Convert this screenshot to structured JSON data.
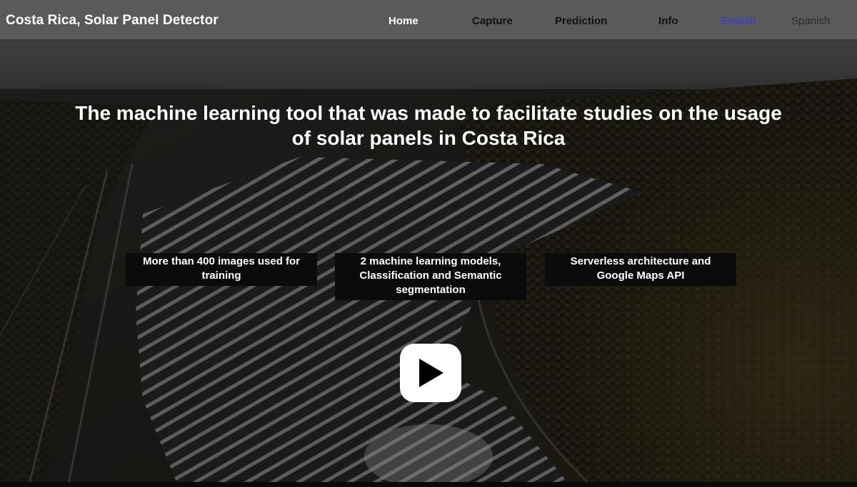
{
  "navbar": {
    "brand": "Costa Rica, Solar Panel Detector",
    "links": [
      {
        "label": "Home",
        "active": true
      },
      {
        "label": "Capture",
        "active": false
      },
      {
        "label": "Prediction",
        "active": false
      },
      {
        "label": "Info",
        "active": false
      }
    ],
    "languages": [
      {
        "label": "English",
        "selected": true
      },
      {
        "label": "Spanish",
        "selected": false
      }
    ]
  },
  "hero": {
    "title": "The machine learning tool that was made to facilitate studies on the usage of solar panels in Costa Rica",
    "background_image": "aerial-solar-farm-photo"
  },
  "features": [
    {
      "text": "More than 400 images used for training"
    },
    {
      "text": "2 machine learning models, Classification and Semantic segmentation"
    },
    {
      "text": "Serverless architecture and Google Maps API"
    }
  ],
  "video": {
    "play_icon": "play-icon"
  },
  "colors": {
    "navbar_bg": "#5c5c5c",
    "active_link": "#ffffff",
    "link": "#111111",
    "english_link": "#3b3bd6",
    "card_bg": "#0b0b0b",
    "play_button_bg": "#ffffff"
  }
}
